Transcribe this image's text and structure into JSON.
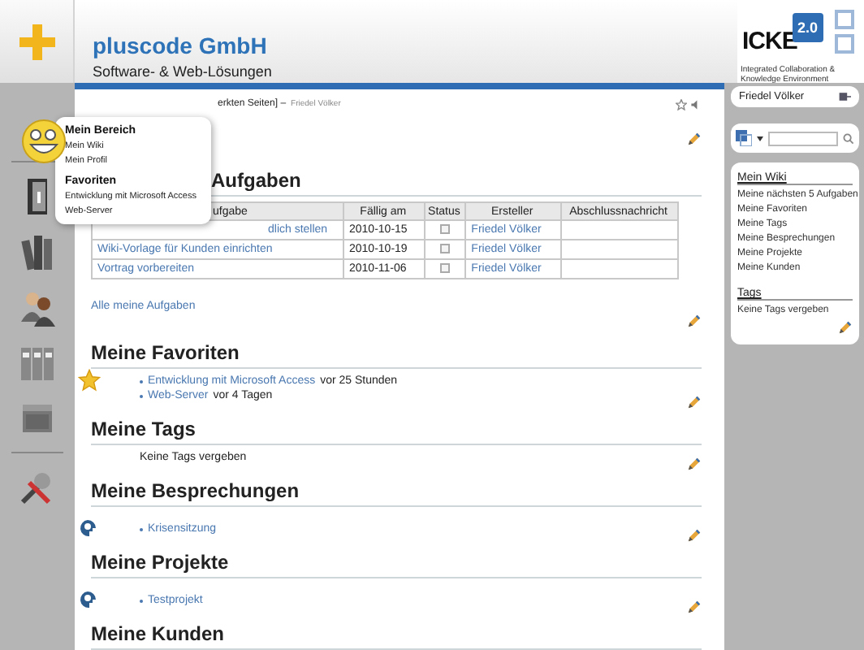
{
  "header": {
    "title": "pluscode GmbH",
    "subtitle": "Software- & Web-Lösungen"
  },
  "logo": {
    "name": "ICKE",
    "version": "2.0",
    "tagline": "Integrated Collaboration & Knowledge Environment"
  },
  "menu": {
    "sections": [
      {
        "title": "Mein Bereich",
        "items": [
          "Mein Wiki",
          "Mein Profil"
        ]
      },
      {
        "title": "Favoriten",
        "items": [
          "Entwicklung mit Microsoft Access",
          "Web-Server"
        ]
      }
    ]
  },
  "breadcrumb": {
    "text": "erkten Seiten] –",
    "user": "Friedel Völker"
  },
  "tasks": {
    "title": "Aufgaben",
    "columns": [
      "ufgabe",
      "Fällig am",
      "Status",
      "Ersteller",
      "Abschlussnachricht"
    ],
    "rows": [
      {
        "task": "dlich stellen",
        "due": "2010-10-15",
        "checked": false,
        "creator": "Friedel Völker"
      },
      {
        "task": "Wiki-Vorlage für Kunden einrichten",
        "due": "2010-10-19",
        "checked": false,
        "creator": "Friedel Völker"
      },
      {
        "task": "Vortrag vorbereiten",
        "due": "2010-11-06",
        "checked": false,
        "creator": "Friedel Völker"
      }
    ],
    "link": "Alle meine Aufgaben"
  },
  "sections": [
    {
      "kind": "favorites",
      "title": "Meine Favoriten",
      "items": [
        {
          "link": "Entwicklung mit Microsoft Access",
          "time": "vor 25 Stunden"
        },
        {
          "link": "Web-Server",
          "time": "vor 4 Tagen"
        }
      ]
    },
    {
      "kind": "note",
      "title": "Meine Tags",
      "text": "Keine Tags vergeben"
    },
    {
      "kind": "people",
      "title": "Meine Besprechungen",
      "items": [
        {
          "link": "Krisensitzung"
        }
      ]
    },
    {
      "kind": "people",
      "title": "Meine Projekte",
      "items": [
        {
          "link": "Testprojekt"
        }
      ]
    },
    {
      "kind": "empty",
      "title": "Meine Kunden"
    }
  ],
  "user_box": {
    "name": "Friedel Völker"
  },
  "wiki_panel": {
    "title": "Mein Wiki",
    "links": [
      "Meine nächsten 5 Aufgaben",
      "Meine Favoriten",
      "Meine Tags",
      "Meine Besprechungen",
      "Meine Projekte",
      "Meine Kunden"
    ],
    "tags_title": "Tags",
    "tags_text": "Keine Tags vergeben"
  }
}
